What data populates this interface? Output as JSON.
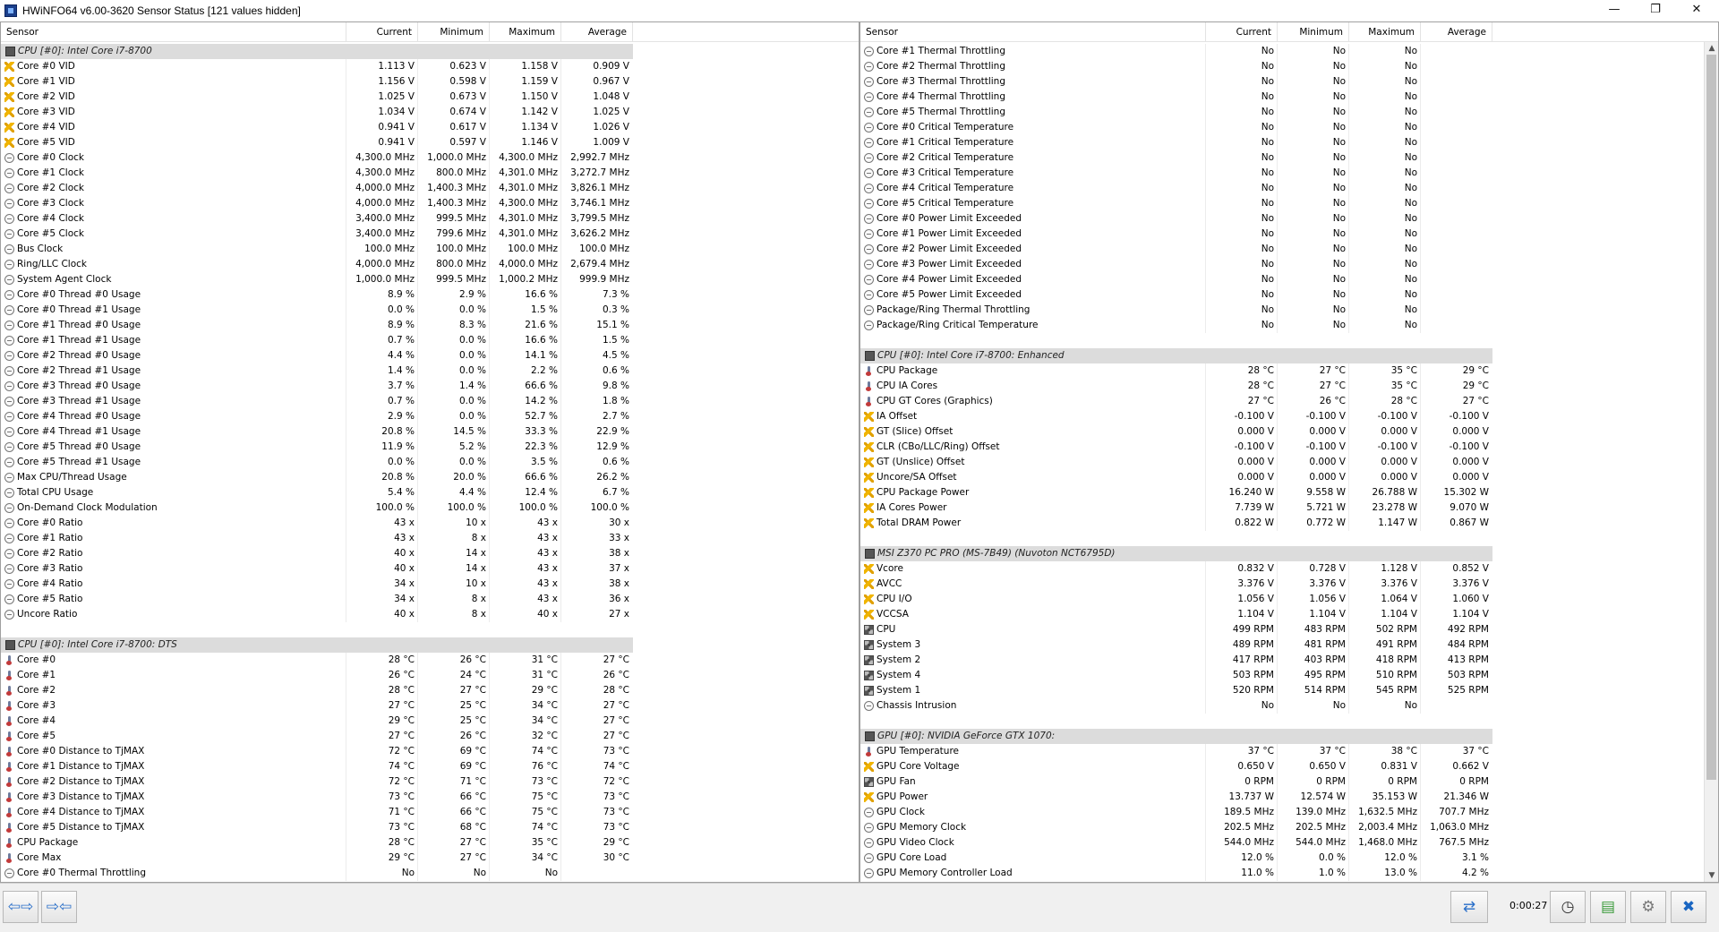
{
  "window": {
    "title": "HWiNFO64 v6.00-3620 Sensor Status [121 values hidden]",
    "minimize": "—",
    "restore": "❐",
    "close": "✕"
  },
  "columns": {
    "sensor": "Sensor",
    "current": "Current",
    "minimum": "Minimum",
    "maximum": "Maximum",
    "average": "Average"
  },
  "left": [
    {
      "g": "CPU [#0]: Intel Core i7-8700"
    },
    {
      "i": "bolt",
      "n": "Core #0 VID",
      "c": "1.113 V",
      "mn": "0.623 V",
      "mx": "1.158 V",
      "a": "0.909 V"
    },
    {
      "i": "bolt",
      "n": "Core #1 VID",
      "c": "1.156 V",
      "mn": "0.598 V",
      "mx": "1.159 V",
      "a": "0.967 V"
    },
    {
      "i": "bolt",
      "n": "Core #2 VID",
      "c": "1.025 V",
      "mn": "0.673 V",
      "mx": "1.150 V",
      "a": "1.048 V"
    },
    {
      "i": "bolt",
      "n": "Core #3 VID",
      "c": "1.034 V",
      "mn": "0.674 V",
      "mx": "1.142 V",
      "a": "1.025 V"
    },
    {
      "i": "bolt",
      "n": "Core #4 VID",
      "c": "0.941 V",
      "mn": "0.617 V",
      "mx": "1.134 V",
      "a": "1.026 V"
    },
    {
      "i": "bolt",
      "n": "Core #5 VID",
      "c": "0.941 V",
      "mn": "0.597 V",
      "mx": "1.146 V",
      "a": "1.009 V"
    },
    {
      "i": "circle",
      "n": "Core #0 Clock",
      "c": "4,300.0 MHz",
      "mn": "1,000.0 MHz",
      "mx": "4,300.0 MHz",
      "a": "2,992.7 MHz"
    },
    {
      "i": "circle",
      "n": "Core #1 Clock",
      "c": "4,300.0 MHz",
      "mn": "800.0 MHz",
      "mx": "4,301.0 MHz",
      "a": "3,272.7 MHz"
    },
    {
      "i": "circle",
      "n": "Core #2 Clock",
      "c": "4,000.0 MHz",
      "mn": "1,400.3 MHz",
      "mx": "4,301.0 MHz",
      "a": "3,826.1 MHz"
    },
    {
      "i": "circle",
      "n": "Core #3 Clock",
      "c": "4,000.0 MHz",
      "mn": "1,400.3 MHz",
      "mx": "4,300.0 MHz",
      "a": "3,746.1 MHz"
    },
    {
      "i": "circle",
      "n": "Core #4 Clock",
      "c": "3,400.0 MHz",
      "mn": "999.5 MHz",
      "mx": "4,301.0 MHz",
      "a": "3,799.5 MHz"
    },
    {
      "i": "circle",
      "n": "Core #5 Clock",
      "c": "3,400.0 MHz",
      "mn": "799.6 MHz",
      "mx": "4,301.0 MHz",
      "a": "3,626.2 MHz"
    },
    {
      "i": "circle",
      "n": "Bus Clock",
      "c": "100.0 MHz",
      "mn": "100.0 MHz",
      "mx": "100.0 MHz",
      "a": "100.0 MHz"
    },
    {
      "i": "circle",
      "n": "Ring/LLC Clock",
      "c": "4,000.0 MHz",
      "mn": "800.0 MHz",
      "mx": "4,000.0 MHz",
      "a": "2,679.4 MHz"
    },
    {
      "i": "circle",
      "n": "System Agent Clock",
      "c": "1,000.0 MHz",
      "mn": "999.5 MHz",
      "mx": "1,000.2 MHz",
      "a": "999.9 MHz"
    },
    {
      "i": "circle",
      "n": "Core #0 Thread #0 Usage",
      "c": "8.9 %",
      "mn": "2.9 %",
      "mx": "16.6 %",
      "a": "7.3 %"
    },
    {
      "i": "circle",
      "n": "Core #0 Thread #1 Usage",
      "c": "0.0 %",
      "mn": "0.0 %",
      "mx": "1.5 %",
      "a": "0.3 %"
    },
    {
      "i": "circle",
      "n": "Core #1 Thread #0 Usage",
      "c": "8.9 %",
      "mn": "8.3 %",
      "mx": "21.6 %",
      "a": "15.1 %"
    },
    {
      "i": "circle",
      "n": "Core #1 Thread #1 Usage",
      "c": "0.7 %",
      "mn": "0.0 %",
      "mx": "16.6 %",
      "a": "1.5 %"
    },
    {
      "i": "circle",
      "n": "Core #2 Thread #0 Usage",
      "c": "4.4 %",
      "mn": "0.0 %",
      "mx": "14.1 %",
      "a": "4.5 %"
    },
    {
      "i": "circle",
      "n": "Core #2 Thread #1 Usage",
      "c": "1.4 %",
      "mn": "0.0 %",
      "mx": "2.2 %",
      "a": "0.6 %"
    },
    {
      "i": "circle",
      "n": "Core #3 Thread #0 Usage",
      "c": "3.7 %",
      "mn": "1.4 %",
      "mx": "66.6 %",
      "a": "9.8 %"
    },
    {
      "i": "circle",
      "n": "Core #3 Thread #1 Usage",
      "c": "0.7 %",
      "mn": "0.0 %",
      "mx": "14.2 %",
      "a": "1.8 %"
    },
    {
      "i": "circle",
      "n": "Core #4 Thread #0 Usage",
      "c": "2.9 %",
      "mn": "0.0 %",
      "mx": "52.7 %",
      "a": "2.7 %"
    },
    {
      "i": "circle",
      "n": "Core #4 Thread #1 Usage",
      "c": "20.8 %",
      "mn": "14.5 %",
      "mx": "33.3 %",
      "a": "22.9 %"
    },
    {
      "i": "circle",
      "n": "Core #5 Thread #0 Usage",
      "c": "11.9 %",
      "mn": "5.2 %",
      "mx": "22.3 %",
      "a": "12.9 %"
    },
    {
      "i": "circle",
      "n": "Core #5 Thread #1 Usage",
      "c": "0.0 %",
      "mn": "0.0 %",
      "mx": "3.5 %",
      "a": "0.6 %"
    },
    {
      "i": "circle",
      "n": "Max CPU/Thread Usage",
      "c": "20.8 %",
      "mn": "20.0 %",
      "mx": "66.6 %",
      "a": "26.2 %"
    },
    {
      "i": "circle",
      "n": "Total CPU Usage",
      "c": "5.4 %",
      "mn": "4.4 %",
      "mx": "12.4 %",
      "a": "6.7 %"
    },
    {
      "i": "circle",
      "n": "On-Demand Clock Modulation",
      "c": "100.0 %",
      "mn": "100.0 %",
      "mx": "100.0 %",
      "a": "100.0 %"
    },
    {
      "i": "circle",
      "n": "Core #0 Ratio",
      "c": "43 x",
      "mn": "10 x",
      "mx": "43 x",
      "a": "30 x"
    },
    {
      "i": "circle",
      "n": "Core #1 Ratio",
      "c": "43 x",
      "mn": "8 x",
      "mx": "43 x",
      "a": "33 x"
    },
    {
      "i": "circle",
      "n": "Core #2 Ratio",
      "c": "40 x",
      "mn": "14 x",
      "mx": "43 x",
      "a": "38 x"
    },
    {
      "i": "circle",
      "n": "Core #3 Ratio",
      "c": "40 x",
      "mn": "14 x",
      "mx": "43 x",
      "a": "37 x"
    },
    {
      "i": "circle",
      "n": "Core #4 Ratio",
      "c": "34 x",
      "mn": "10 x",
      "mx": "43 x",
      "a": "38 x"
    },
    {
      "i": "circle",
      "n": "Core #5 Ratio",
      "c": "34 x",
      "mn": "8 x",
      "mx": "43 x",
      "a": "36 x"
    },
    {
      "i": "circle",
      "n": "Uncore Ratio",
      "c": "40 x",
      "mn": "8 x",
      "mx": "40 x",
      "a": "27 x"
    },
    {
      "blank": true
    },
    {
      "g": "CPU [#0]: Intel Core i7-8700: DTS"
    },
    {
      "i": "therm",
      "n": "Core #0",
      "c": "28 °C",
      "mn": "26 °C",
      "mx": "31 °C",
      "a": "27 °C"
    },
    {
      "i": "therm",
      "n": "Core #1",
      "c": "26 °C",
      "mn": "24 °C",
      "mx": "31 °C",
      "a": "26 °C"
    },
    {
      "i": "therm",
      "n": "Core #2",
      "c": "28 °C",
      "mn": "27 °C",
      "mx": "29 °C",
      "a": "28 °C"
    },
    {
      "i": "therm",
      "n": "Core #3",
      "c": "27 °C",
      "mn": "25 °C",
      "mx": "34 °C",
      "a": "27 °C"
    },
    {
      "i": "therm",
      "n": "Core #4",
      "c": "29 °C",
      "mn": "25 °C",
      "mx": "34 °C",
      "a": "27 °C"
    },
    {
      "i": "therm",
      "n": "Core #5",
      "c": "27 °C",
      "mn": "26 °C",
      "mx": "32 °C",
      "a": "27 °C"
    },
    {
      "i": "therm",
      "n": "Core #0 Distance to TjMAX",
      "c": "72 °C",
      "mn": "69 °C",
      "mx": "74 °C",
      "a": "73 °C"
    },
    {
      "i": "therm",
      "n": "Core #1 Distance to TjMAX",
      "c": "74 °C",
      "mn": "69 °C",
      "mx": "76 °C",
      "a": "74 °C"
    },
    {
      "i": "therm",
      "n": "Core #2 Distance to TjMAX",
      "c": "72 °C",
      "mn": "71 °C",
      "mx": "73 °C",
      "a": "72 °C"
    },
    {
      "i": "therm",
      "n": "Core #3 Distance to TjMAX",
      "c": "73 °C",
      "mn": "66 °C",
      "mx": "75 °C",
      "a": "73 °C"
    },
    {
      "i": "therm",
      "n": "Core #4 Distance to TjMAX",
      "c": "71 °C",
      "mn": "66 °C",
      "mx": "75 °C",
      "a": "73 °C"
    },
    {
      "i": "therm",
      "n": "Core #5 Distance to TjMAX",
      "c": "73 °C",
      "mn": "68 °C",
      "mx": "74 °C",
      "a": "73 °C"
    },
    {
      "i": "therm",
      "n": "CPU Package",
      "c": "28 °C",
      "mn": "27 °C",
      "mx": "35 °C",
      "a": "29 °C"
    },
    {
      "i": "therm",
      "n": "Core Max",
      "c": "29 °C",
      "mn": "27 °C",
      "mx": "34 °C",
      "a": "30 °C"
    },
    {
      "i": "circle",
      "n": "Core #0 Thermal Throttling",
      "c": "No",
      "mn": "No",
      "mx": "No",
      "a": ""
    }
  ],
  "right": [
    {
      "i": "circle",
      "n": "Core #1 Thermal Throttling",
      "c": "No",
      "mn": "No",
      "mx": "No",
      "a": ""
    },
    {
      "i": "circle",
      "n": "Core #2 Thermal Throttling",
      "c": "No",
      "mn": "No",
      "mx": "No",
      "a": ""
    },
    {
      "i": "circle",
      "n": "Core #3 Thermal Throttling",
      "c": "No",
      "mn": "No",
      "mx": "No",
      "a": ""
    },
    {
      "i": "circle",
      "n": "Core #4 Thermal Throttling",
      "c": "No",
      "mn": "No",
      "mx": "No",
      "a": ""
    },
    {
      "i": "circle",
      "n": "Core #5 Thermal Throttling",
      "c": "No",
      "mn": "No",
      "mx": "No",
      "a": ""
    },
    {
      "i": "circle",
      "n": "Core #0 Critical Temperature",
      "c": "No",
      "mn": "No",
      "mx": "No",
      "a": ""
    },
    {
      "i": "circle",
      "n": "Core #1 Critical Temperature",
      "c": "No",
      "mn": "No",
      "mx": "No",
      "a": ""
    },
    {
      "i": "circle",
      "n": "Core #2 Critical Temperature",
      "c": "No",
      "mn": "No",
      "mx": "No",
      "a": ""
    },
    {
      "i": "circle",
      "n": "Core #3 Critical Temperature",
      "c": "No",
      "mn": "No",
      "mx": "No",
      "a": ""
    },
    {
      "i": "circle",
      "n": "Core #4 Critical Temperature",
      "c": "No",
      "mn": "No",
      "mx": "No",
      "a": ""
    },
    {
      "i": "circle",
      "n": "Core #5 Critical Temperature",
      "c": "No",
      "mn": "No",
      "mx": "No",
      "a": ""
    },
    {
      "i": "circle",
      "n": "Core #0 Power Limit Exceeded",
      "c": "No",
      "mn": "No",
      "mx": "No",
      "a": ""
    },
    {
      "i": "circle",
      "n": "Core #1 Power Limit Exceeded",
      "c": "No",
      "mn": "No",
      "mx": "No",
      "a": ""
    },
    {
      "i": "circle",
      "n": "Core #2 Power Limit Exceeded",
      "c": "No",
      "mn": "No",
      "mx": "No",
      "a": ""
    },
    {
      "i": "circle",
      "n": "Core #3 Power Limit Exceeded",
      "c": "No",
      "mn": "No",
      "mx": "No",
      "a": ""
    },
    {
      "i": "circle",
      "n": "Core #4 Power Limit Exceeded",
      "c": "No",
      "mn": "No",
      "mx": "No",
      "a": ""
    },
    {
      "i": "circle",
      "n": "Core #5 Power Limit Exceeded",
      "c": "No",
      "mn": "No",
      "mx": "No",
      "a": ""
    },
    {
      "i": "circle",
      "n": "Package/Ring Thermal Throttling",
      "c": "No",
      "mn": "No",
      "mx": "No",
      "a": ""
    },
    {
      "i": "circle",
      "n": "Package/Ring Critical Temperature",
      "c": "No",
      "mn": "No",
      "mx": "No",
      "a": ""
    },
    {
      "blank": true
    },
    {
      "g": "CPU [#0]: Intel Core i7-8700: Enhanced"
    },
    {
      "i": "therm",
      "n": "CPU Package",
      "c": "28 °C",
      "mn": "27 °C",
      "mx": "35 °C",
      "a": "29 °C"
    },
    {
      "i": "therm",
      "n": "CPU IA Cores",
      "c": "28 °C",
      "mn": "27 °C",
      "mx": "35 °C",
      "a": "29 °C"
    },
    {
      "i": "therm",
      "n": "CPU GT Cores (Graphics)",
      "c": "27 °C",
      "mn": "26 °C",
      "mx": "28 °C",
      "a": "27 °C"
    },
    {
      "i": "bolt",
      "n": "IA Offset",
      "c": "-0.100 V",
      "mn": "-0.100 V",
      "mx": "-0.100 V",
      "a": "-0.100 V"
    },
    {
      "i": "bolt",
      "n": "GT (Slice) Offset",
      "c": "0.000 V",
      "mn": "0.000 V",
      "mx": "0.000 V",
      "a": "0.000 V"
    },
    {
      "i": "bolt",
      "n": "CLR (CBo/LLC/Ring) Offset",
      "c": "-0.100 V",
      "mn": "-0.100 V",
      "mx": "-0.100 V",
      "a": "-0.100 V"
    },
    {
      "i": "bolt",
      "n": "GT (Unslice) Offset",
      "c": "0.000 V",
      "mn": "0.000 V",
      "mx": "0.000 V",
      "a": "0.000 V"
    },
    {
      "i": "bolt",
      "n": "Uncore/SA Offset",
      "c": "0.000 V",
      "mn": "0.000 V",
      "mx": "0.000 V",
      "a": "0.000 V"
    },
    {
      "i": "bolt",
      "n": "CPU Package Power",
      "c": "16.240 W",
      "mn": "9.558 W",
      "mx": "26.788 W",
      "a": "15.302 W"
    },
    {
      "i": "bolt",
      "n": "IA Cores Power",
      "c": "7.739 W",
      "mn": "5.721 W",
      "mx": "23.278 W",
      "a": "9.070 W"
    },
    {
      "i": "bolt",
      "n": "Total DRAM Power",
      "c": "0.822 W",
      "mn": "0.772 W",
      "mx": "1.147 W",
      "a": "0.867 W"
    },
    {
      "blank": true
    },
    {
      "g": "MSI Z370 PC PRO (MS-7B49) (Nuvoton NCT6795D)"
    },
    {
      "i": "bolt",
      "n": "Vcore",
      "c": "0.832 V",
      "mn": "0.728 V",
      "mx": "1.128 V",
      "a": "0.852 V"
    },
    {
      "i": "bolt",
      "n": "AVCC",
      "c": "3.376 V",
      "mn": "3.376 V",
      "mx": "3.376 V",
      "a": "3.376 V"
    },
    {
      "i": "bolt",
      "n": "CPU I/O",
      "c": "1.056 V",
      "mn": "1.056 V",
      "mx": "1.064 V",
      "a": "1.060 V"
    },
    {
      "i": "bolt",
      "n": "VCCSA",
      "c": "1.104 V",
      "mn": "1.104 V",
      "mx": "1.104 V",
      "a": "1.104 V"
    },
    {
      "i": "fan",
      "n": "CPU",
      "c": "499 RPM",
      "mn": "483 RPM",
      "mx": "502 RPM",
      "a": "492 RPM"
    },
    {
      "i": "fan",
      "n": "System 3",
      "c": "489 RPM",
      "mn": "481 RPM",
      "mx": "491 RPM",
      "a": "484 RPM"
    },
    {
      "i": "fan",
      "n": "System 2",
      "c": "417 RPM",
      "mn": "403 RPM",
      "mx": "418 RPM",
      "a": "413 RPM"
    },
    {
      "i": "fan",
      "n": "System 4",
      "c": "503 RPM",
      "mn": "495 RPM",
      "mx": "510 RPM",
      "a": "503 RPM"
    },
    {
      "i": "fan",
      "n": "System 1",
      "c": "520 RPM",
      "mn": "514 RPM",
      "mx": "545 RPM",
      "a": "525 RPM"
    },
    {
      "i": "circle",
      "n": "Chassis Intrusion",
      "c": "No",
      "mn": "No",
      "mx": "No",
      "a": ""
    },
    {
      "blank": true
    },
    {
      "g": "GPU [#0]: NVIDIA GeForce GTX 1070:"
    },
    {
      "i": "therm",
      "n": "GPU Temperature",
      "c": "37 °C",
      "mn": "37 °C",
      "mx": "38 °C",
      "a": "37 °C"
    },
    {
      "i": "bolt",
      "n": "GPU Core Voltage",
      "c": "0.650 V",
      "mn": "0.650 V",
      "mx": "0.831 V",
      "a": "0.662 V"
    },
    {
      "i": "fan",
      "n": "GPU Fan",
      "c": "0 RPM",
      "mn": "0 RPM",
      "mx": "0 RPM",
      "a": "0 RPM"
    },
    {
      "i": "bolt",
      "n": "GPU Power",
      "c": "13.737 W",
      "mn": "12.574 W",
      "mx": "35.153 W",
      "a": "21.346 W"
    },
    {
      "i": "circle",
      "n": "GPU Clock",
      "c": "189.5 MHz",
      "mn": "139.0 MHz",
      "mx": "1,632.5 MHz",
      "a": "707.7 MHz"
    },
    {
      "i": "circle",
      "n": "GPU Memory Clock",
      "c": "202.5 MHz",
      "mn": "202.5 MHz",
      "mx": "2,003.4 MHz",
      "a": "1,063.0 MHz"
    },
    {
      "i": "circle",
      "n": "GPU Video Clock",
      "c": "544.0 MHz",
      "mn": "544.0 MHz",
      "mx": "1,468.0 MHz",
      "a": "767.5 MHz"
    },
    {
      "i": "circle",
      "n": "GPU Core Load",
      "c": "12.0 %",
      "mn": "0.0 %",
      "mx": "12.0 %",
      "a": "3.1 %"
    },
    {
      "i": "circle",
      "n": "GPU Memory Controller Load",
      "c": "11.0 %",
      "mn": "1.0 %",
      "mx": "13.0 %",
      "a": "4.2 %"
    }
  ],
  "statusbar": {
    "nav_left": "⇦⇨",
    "nav_right": "⇨⇦",
    "elapsed": "0:00:27",
    "scroll_up": "▲",
    "scroll_down": "▼"
  }
}
